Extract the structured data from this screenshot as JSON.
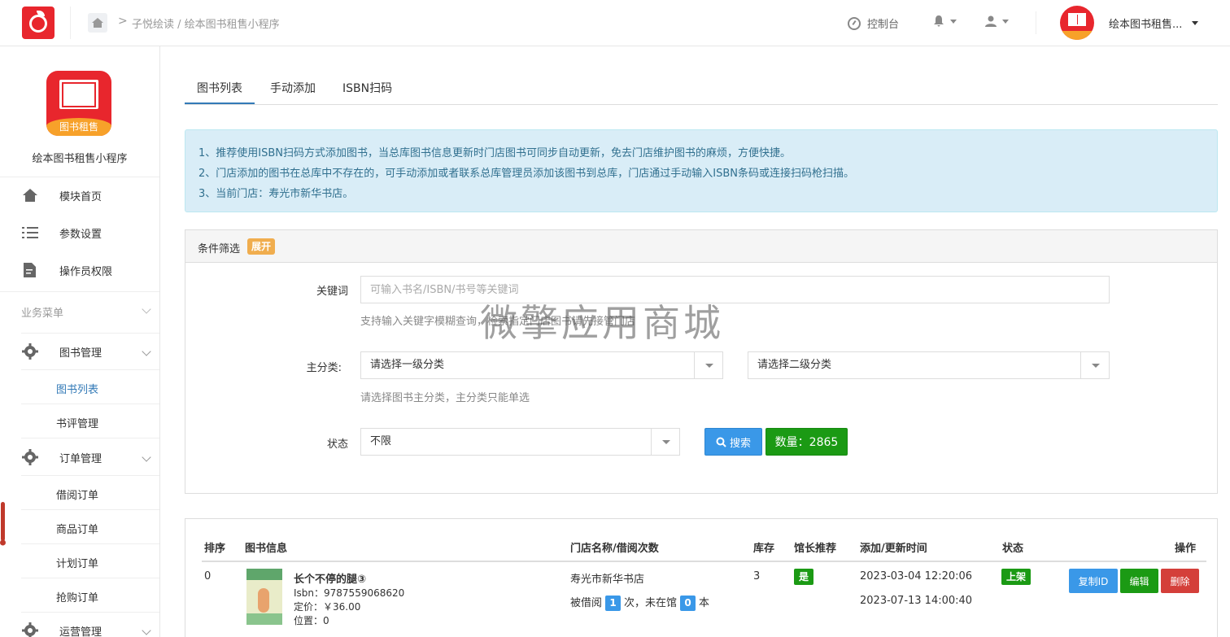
{
  "header": {
    "breadcrumb": "子悦绘读 / 绘本图书租售小程序",
    "console_label": "控制台",
    "store_name": "绘本图书租售..."
  },
  "sidebar": {
    "app_badge": "图书租售",
    "app_name": "绘本图书租售小程序",
    "top_items": [
      {
        "label": "模块首页",
        "icon": "home-icon"
      },
      {
        "label": "参数设置",
        "icon": "list-icon"
      },
      {
        "label": "操作员权限",
        "icon": "document-icon"
      }
    ],
    "section_title": "业务菜单",
    "groups": [
      {
        "label": "图书管理",
        "icon": "gear-icon",
        "children": [
          "图书列表",
          "书评管理"
        ]
      },
      {
        "label": "订单管理",
        "icon": "gear-icon",
        "children": [
          "借阅订单",
          "商品订单",
          "计划订单",
          "抢购订单"
        ]
      },
      {
        "label": "运营管理",
        "icon": "gear-icon"
      }
    ],
    "active_child": "图书列表"
  },
  "tabs": [
    "图书列表",
    "手动添加",
    "ISBN扫码"
  ],
  "alert": [
    "1、推荐使用ISBN扫码方式添加图书，当总库图书信息更新时门店图书可同步自动更新，免去门店维护图书的麻烦，方便快捷。",
    "2、门店添加的图书在总库中不存在的，可手动添加或者联系总库管理员添加该图书到总库，门店通过手动输入ISBN条码或连接扫码枪扫描。",
    "3、当前门店：寿光市新华书店。"
  ],
  "filter": {
    "title": "条件筛选",
    "expand": "展开",
    "keyword_label": "关键词",
    "keyword_placeholder": "可输入书名/ISBN/书号等关键词",
    "keyword_help": "支持输入关键字模糊查询，检索指定门店图书请先接管门店",
    "category_label": "主分类:",
    "category1": "请选择一级分类",
    "category2": "请选择二级分类",
    "category_help": "请选择图书主分类，主分类只能单选",
    "status_label": "状态",
    "status_value": "不限",
    "search_button": "搜索",
    "count_button": "数量：2865"
  },
  "watermark": "微擎应用商城",
  "table": {
    "headers": [
      "排序",
      "图书信息",
      "门店名称/借阅次数",
      "库存",
      "馆长推荐",
      "添加/更新时间",
      "状态",
      "操作"
    ],
    "rows": [
      {
        "sort": "0",
        "title": "长个不停的腿③",
        "isbn": "Isbn：9787559068620",
        "price": "定价：￥36.00",
        "position": "位置：0",
        "store": "寿光市新华书店",
        "borrow_prefix": "被借阅",
        "borrow_count": "1",
        "borrow_mid": "次，未在馆",
        "out_count": "0",
        "borrow_suffix": "本",
        "stock": "3",
        "recommend": "是",
        "added": "2023-03-04 12:20:06",
        "updated": "2023-07-13 14:00:40",
        "status": "上架",
        "actions": [
          "复制ID",
          "编辑",
          "删除"
        ]
      }
    ]
  },
  "colors": {
    "primary": "#3a98e8",
    "success": "#1b9a14",
    "danger": "#d43f3a",
    "brand": "#e8262d"
  }
}
